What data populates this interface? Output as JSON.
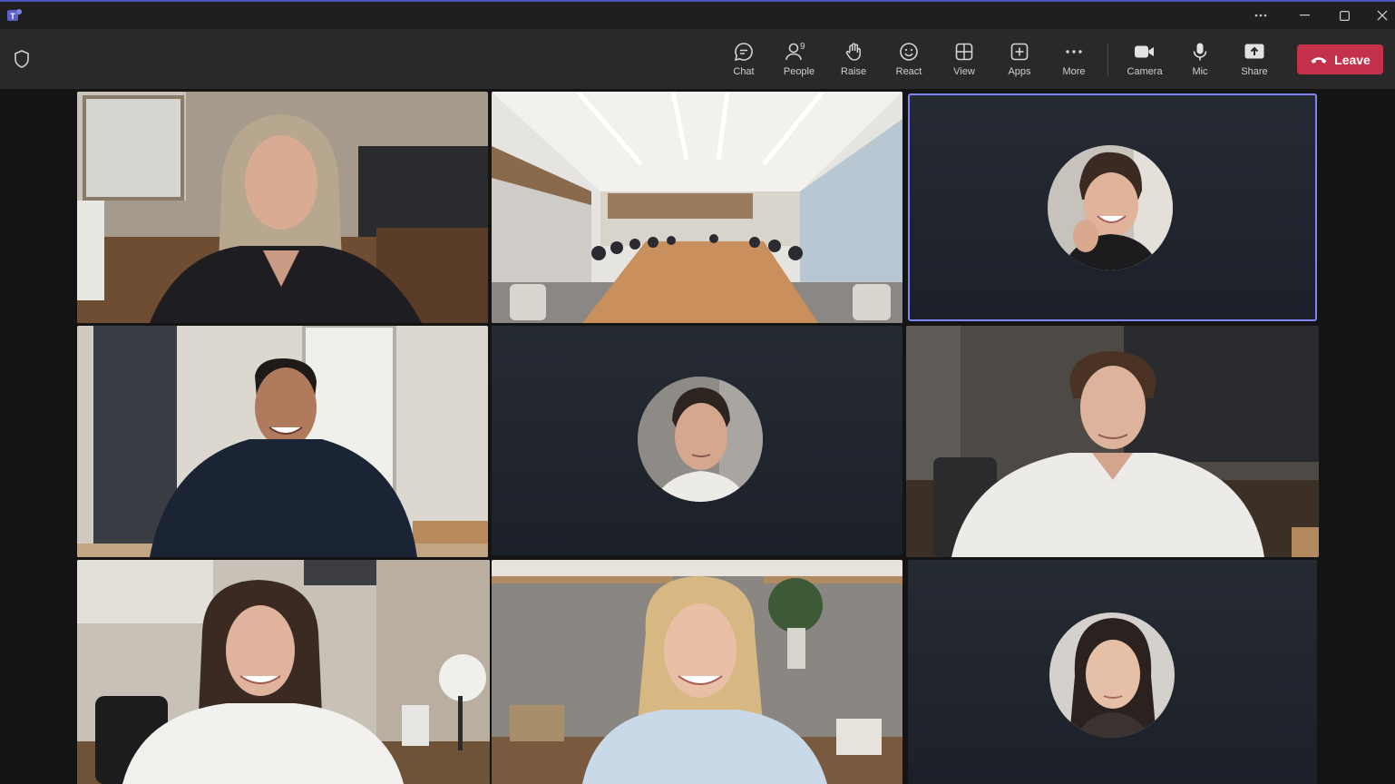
{
  "app": {
    "name": "Microsoft Teams"
  },
  "titlebar": {
    "logo_icon": "teams-logo-icon",
    "more_icon": "ellipsis-icon",
    "minimize_icon": "minimize-icon",
    "maximize_icon": "maximize-icon",
    "close_icon": "close-icon"
  },
  "toolbar": {
    "chat_label": "Chat",
    "people_label": "People",
    "people_count": "9",
    "raise_label": "Raise",
    "react_label": "React",
    "view_label": "View",
    "apps_label": "Apps",
    "more_label": "More",
    "camera_label": "Camera",
    "mic_label": "Mic",
    "share_label": "Share",
    "leave_label": "Leave"
  },
  "colors": {
    "accent": "#4b53bc",
    "active_speaker": "#7f85f5",
    "leave": "#c4314b",
    "background": "#1e1e20"
  },
  "participants": [
    {
      "kind": "video",
      "subject": "woman-gray-hair"
    },
    {
      "kind": "video",
      "subject": "conference-room"
    },
    {
      "kind": "avatar",
      "subject": "young-man-smiling",
      "active_speaker": true
    },
    {
      "kind": "video",
      "subject": "man-dark-sweater"
    },
    {
      "kind": "avatar",
      "subject": "young-man-neutral"
    },
    {
      "kind": "video",
      "subject": "man-white-shirt"
    },
    {
      "kind": "video",
      "subject": "woman-brunette"
    },
    {
      "kind": "video",
      "subject": "woman-blonde"
    },
    {
      "kind": "avatar",
      "subject": "woman-dark-hair"
    }
  ]
}
